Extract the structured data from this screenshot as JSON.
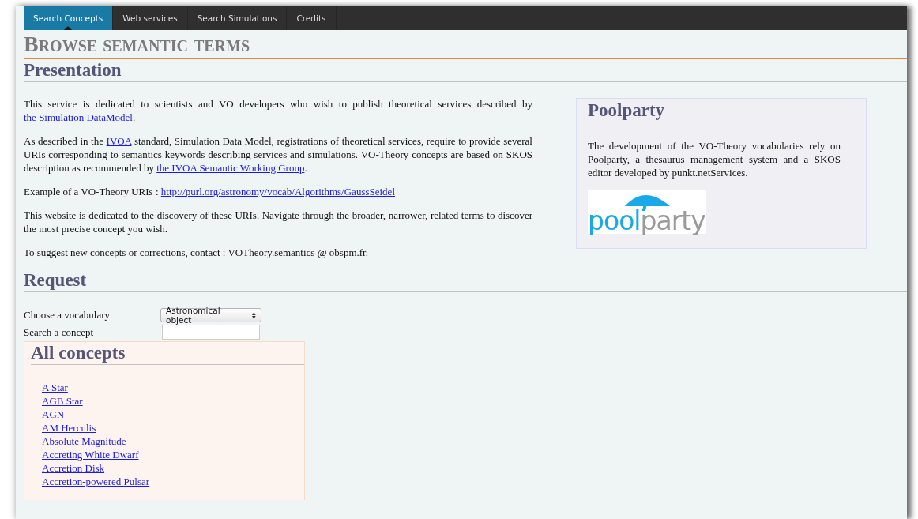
{
  "nav": {
    "tabs": [
      {
        "label": "Search Concepts",
        "selected": true
      },
      {
        "label": "Web services",
        "selected": false
      },
      {
        "label": "Search Simulations",
        "selected": false
      },
      {
        "label": "Credits",
        "selected": false
      }
    ]
  },
  "page_title": "Browse semantic terms",
  "presentation": {
    "heading": "Presentation",
    "paragraphs": [
      [
        {
          "kind": "text",
          "text": "This service is dedicated to scientists and VO developers who wish to publish theoretical services described by "
        },
        {
          "kind": "link",
          "text": "the Simulation DataModel"
        },
        {
          "kind": "text",
          "text": "."
        }
      ],
      [
        {
          "kind": "text",
          "text": "As described in the "
        },
        {
          "kind": "link",
          "text": "IVOA"
        },
        {
          "kind": "text",
          "text": " standard, Simulation Data Model, registrations of theoretical services, require to provide several URIs corresponding to semantics keywords describing services and simulations. VO-Theory concepts are based on SKOS description as recommended by "
        },
        {
          "kind": "link",
          "text": "the IVOA Semantic Working Group"
        },
        {
          "kind": "text",
          "text": "."
        }
      ],
      [
        {
          "kind": "text",
          "text": "Example of a VO-Theory URIs : "
        },
        {
          "kind": "link",
          "text": "http://purl.org/astronomy/vocab/Algorithms/GaussSeidel"
        }
      ],
      [
        {
          "kind": "text",
          "text": "This website is dedicated to the discovery of these URIs. Navigate through the broader, narrower, related terms to discover the most precise concept you wish."
        }
      ],
      [
        {
          "kind": "text",
          "text": "To suggest new concepts or corrections, contact : VOTheory.semantics @ obspm.fr."
        }
      ]
    ]
  },
  "sidebar": {
    "heading": "Poolparty",
    "text": "The development of the VO-Theory vocabularies rely on Poolparty, a thesaurus management system and a SKOS editor developed by punkt.netServices.",
    "logo": {
      "part_1": "pool",
      "part_2": "party"
    }
  },
  "request": {
    "heading": "Request",
    "vocabulary": {
      "label": "Choose a vocabulary",
      "value": "Astronomical object"
    },
    "search": {
      "label": "Search a concept"
    },
    "concepts": {
      "heading": "All concepts",
      "items": [
        "A Star",
        "AGB Star",
        "AGN",
        "AM Herculis",
        "Absolute Magnitude",
        "Accreting White Dwarf",
        "Accretion Disk",
        "Accretion-powered Pulsar"
      ]
    }
  }
}
